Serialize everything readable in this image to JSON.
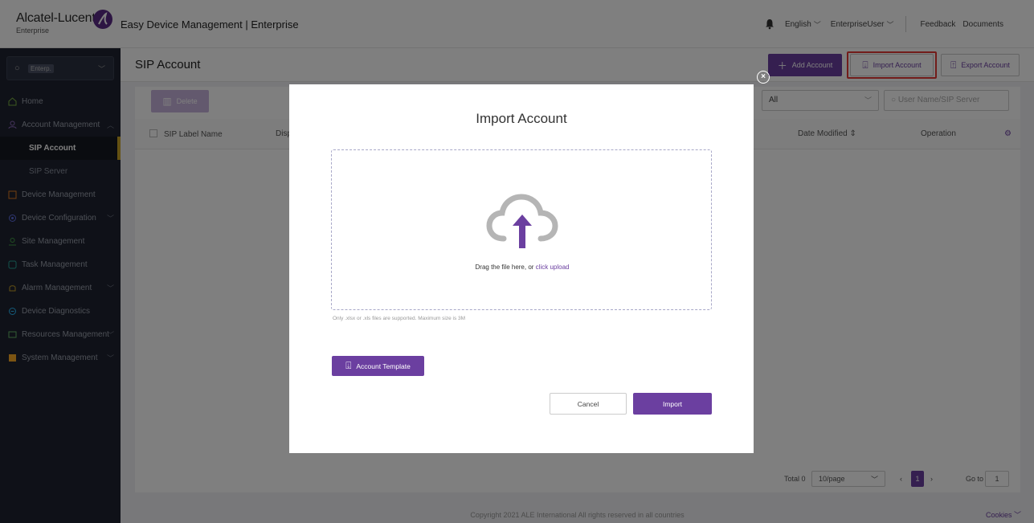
{
  "header": {
    "logo_name": "Alcatel-Lucent",
    "logo_sub": "Enterprise",
    "app_title": "Easy Device Management | Enterprise",
    "language": "English",
    "user": "EnterpriseUser",
    "feedback": "Feedback",
    "documents": "Documents"
  },
  "sidebar": {
    "org_tag": "Enterp.",
    "items": [
      {
        "label": "Home"
      },
      {
        "label": "Account Management"
      },
      {
        "label": "SIP Account"
      },
      {
        "label": "SIP Server"
      },
      {
        "label": "Device Management"
      },
      {
        "label": "Device Configuration"
      },
      {
        "label": "Site Management"
      },
      {
        "label": "Task Management"
      },
      {
        "label": "Alarm Management"
      },
      {
        "label": "Device Diagnostics"
      },
      {
        "label": "Resources Management"
      },
      {
        "label": "System Management"
      }
    ]
  },
  "page": {
    "title": "SIP Account",
    "add_account": "Add Account",
    "import_account": "Import Account",
    "export_account": "Export Account",
    "delete": "Delete",
    "filter_value": "All",
    "search_placeholder": "User Name/SIP Server",
    "columns": {
      "sip_label_name": "SIP Label Name",
      "display": "Disp",
      "date_modified": "Date Modified",
      "operation": "Operation"
    },
    "pager": {
      "total": "Total 0",
      "page_size": "10/page",
      "current_page": "1",
      "go_to": "Go to",
      "go_value": "1"
    },
    "footer": "Copyright 2021 ALE International All rights reserved in all countries",
    "cookies": "Cookies"
  },
  "modal": {
    "title": "Import Account",
    "drop_text": "Drag the file here, or ",
    "drop_link": "click upload",
    "hint": "Only .xlsx or .xls files are supported. Maximum size is 3M",
    "template_button": "Account Template",
    "cancel": "Cancel",
    "import": "Import"
  },
  "colors": {
    "brand": "#6b3fa0",
    "sidebar_bg": "#1f2330",
    "highlight": "#e53935"
  }
}
